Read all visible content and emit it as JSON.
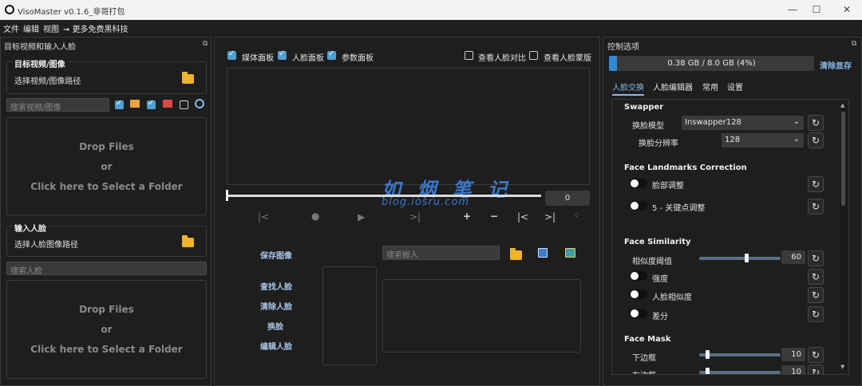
{
  "window": {
    "title": "VisoMaster v0.1.6_非哥打包",
    "controls": [
      "—",
      "☐",
      "✕"
    ]
  },
  "menu": {
    "items": [
      "文件",
      "编辑",
      "视图",
      "➞ 更多免费黑科技"
    ]
  },
  "left_panel": {
    "title": "目标视频和输入人脸",
    "target_group": {
      "label": "目标视频/图像",
      "path_label": "选择视频/图像路径"
    },
    "search_target_placeholder": "搜索视频/图像",
    "dropzone_target": {
      "line1": "Drop Files",
      "line2": "or",
      "line3": "Click here to Select a Folder"
    },
    "input_group": {
      "label": "输入人脸",
      "path_label": "选择人脸图像路径"
    },
    "search_face_placeholder": "搜索人脸",
    "dropzone_face": {
      "line1": "Drop Files",
      "line2": "or",
      "line3": "Click here to Select a Folder"
    }
  },
  "center": {
    "checks": {
      "media_panel": "媒体面板",
      "face_panel": "人脸面板",
      "param_panel": "参数面板",
      "compare": "查看人脸对比",
      "mask": "查看人脸蒙版"
    },
    "frame_value": "0",
    "actions": {
      "save_image": "保存图像",
      "find_faces": "查找人脸",
      "clear_faces": "清除人脸",
      "swap": "换脸",
      "edit_faces": "编辑人脸"
    },
    "search_embed_placeholder": "搜索嵌入",
    "watermark": {
      "text": "如 烟 笔 记",
      "sub": "blog.iosru.com"
    }
  },
  "right_panel": {
    "title": "控制选项",
    "memory": {
      "text": "0.38 GB / 8.0 GB (4%)",
      "percent": 4
    },
    "clear_cache": "清除显存",
    "tabs": [
      "人脸交换",
      "人脸编辑器",
      "常用",
      "设置"
    ],
    "swapper": {
      "title": "Swapper",
      "model_label": "换脸模型",
      "model_value": "Inswapper128",
      "resolution_label": "换脸分辨率",
      "resolution_value": "128"
    },
    "landmarks": {
      "title": "Face Landmarks Correction",
      "toggle1": "脸部调整",
      "toggle2": "5 - 关键点调整"
    },
    "similarity": {
      "title": "Face Similarity",
      "threshold_label": "相似度阈值",
      "threshold_value": "60",
      "strength": "强度",
      "face_sim": "人脸相似度",
      "diff": "差分"
    },
    "mask": {
      "title": "Face Mask",
      "bottom_label": "下边框",
      "bottom_value": "10",
      "left_label": "左边框",
      "left_value": "10"
    }
  }
}
